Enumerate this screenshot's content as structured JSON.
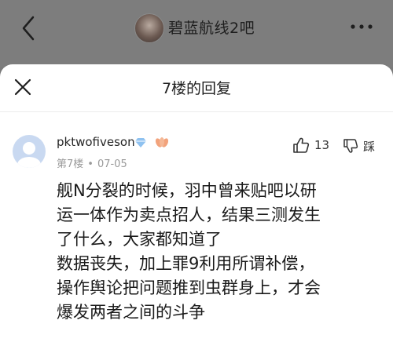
{
  "header": {
    "forum_title": "碧蓝航线2吧"
  },
  "sheet": {
    "title": "7楼的回复"
  },
  "post": {
    "username": "pktwofiveson",
    "floor": "第7楼",
    "separator": "•",
    "date": "07-05",
    "like_count": "13",
    "dislike_label": "踩",
    "lines": [
      "舰N分裂的时候，羽中曾来贴吧以研",
      "运一体作为卖点招人，结果三测发生",
      "了什么，大家都知道了",
      "数据丧失，加上罪9利用所谓补偿，",
      "操作舆论把问题推到虫群身上，才会",
      "爆发两者之间的斗争"
    ]
  },
  "colors": {
    "overlay": "#7a7a7a",
    "sheet_bg": "#ffffff",
    "meta_text": "#9a9a9a",
    "diamond_badge": "#8fc2f0",
    "bloom_badge": "#f2a37c"
  }
}
